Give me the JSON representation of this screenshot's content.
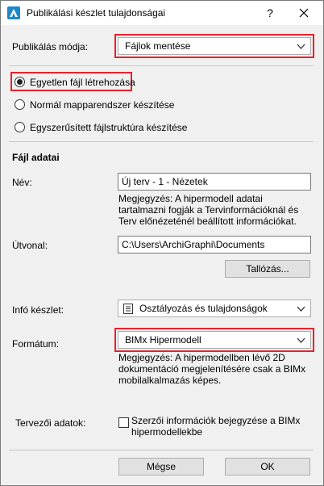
{
  "window": {
    "title": "Publikálási készlet tulajdonságai",
    "help_glyph": "?",
    "close_glyph": "✕"
  },
  "publish_mode": {
    "label": "Publikálás módja:",
    "selected": "Fájlok mentése"
  },
  "radio_options": [
    {
      "label": "Egyetlen fájl létrehozása",
      "checked": true
    },
    {
      "label": "Normál mapparendszer készítése",
      "checked": false
    },
    {
      "label": "Egyszerűsített fájlstruktúra készítése",
      "checked": false
    }
  ],
  "file_data": {
    "heading": "Fájl adatai",
    "name_label": "Név:",
    "name_value": "Új terv - 1 - Nézetek",
    "name_note": "Megjegyzés: A hipermodell adatai tartalmazni fogják a Tervinformációknál és Terv előnézeténél beállított információkat.",
    "path_label": "Útvonal:",
    "path_value": "C:\\Users\\ArchiGraphi\\Documents",
    "browse_button": "Tallózás...",
    "info_label": "Infó készlet:",
    "info_selected": "Osztályozás és tulajdonságok",
    "format_label": "Formátum:",
    "format_selected": "BIMx Hipermodell",
    "format_note": "Megjegyzés: A hipermodellben lévő 2D dokumentáció megjelenítésére csak a BIMx mobilalkalmazás képes.",
    "designer_label": "Tervezői adatok:",
    "designer_checkbox_label": "Szerzői információk bejegyzése a BIMx hipermodellekbe",
    "designer_checked": false
  },
  "footer": {
    "cancel": "Mégse",
    "ok": "OK"
  },
  "colors": {
    "highlight": "#e8222b",
    "background": "#f0f0f0"
  }
}
